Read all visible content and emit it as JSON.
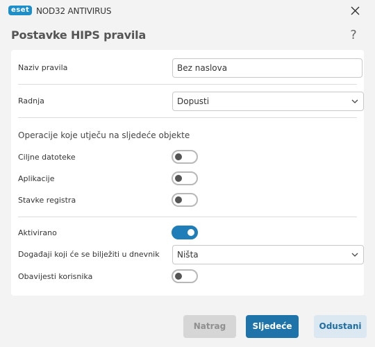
{
  "window": {
    "logo_text": "eset",
    "app_title": "NOD32 ANTIVIRUS",
    "close_icon": "close-icon"
  },
  "dialog": {
    "title": "Postavke HIPS pravila",
    "help_label": "?"
  },
  "form": {
    "rule_name_label": "Naziv pravila",
    "rule_name_value": "Bez naslova",
    "action_label": "Radnja",
    "action_value": "Dopusti",
    "operations_heading": "Operacije koje utječu na sljedeće objekte",
    "target_files_label": "Ciljne datoteke",
    "target_files_on": false,
    "applications_label": "Aplikacije",
    "applications_on": false,
    "registry_label": "Stavke registra",
    "registry_on": false,
    "enabled_label": "Aktivirano",
    "enabled_on": true,
    "log_label": "Događaji koji će se bilježiti u dnevnik",
    "log_value": "Ništa",
    "notify_label": "Obavijesti korisnika",
    "notify_on": false
  },
  "footer": {
    "back_label": "Natrag",
    "next_label": "Sljedeće",
    "cancel_label": "Odustani"
  },
  "colors": {
    "accent": "#1e73a8",
    "logo": "#1e8ec9"
  }
}
